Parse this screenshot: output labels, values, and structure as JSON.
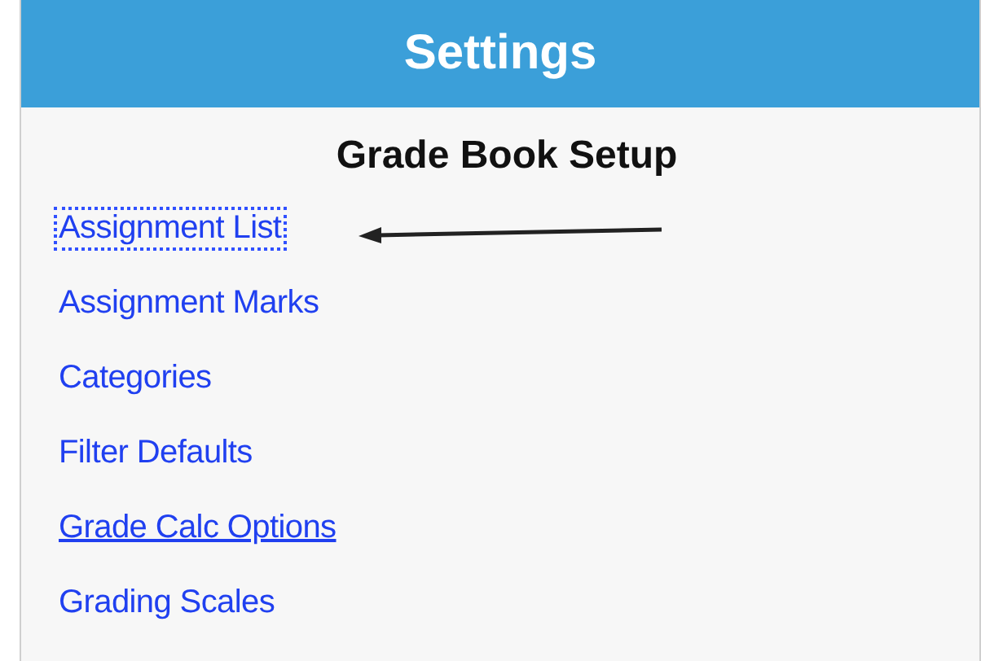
{
  "panel": {
    "title": "Settings",
    "heading": "Grade Book Setup"
  },
  "links": [
    {
      "label": "Assignment List",
      "focused": true,
      "hovered": false
    },
    {
      "label": "Assignment Marks",
      "focused": false,
      "hovered": false
    },
    {
      "label": "Categories",
      "focused": false,
      "hovered": false
    },
    {
      "label": "Filter Defaults",
      "focused": false,
      "hovered": false
    },
    {
      "label": "Grade Calc Options",
      "focused": false,
      "hovered": true
    },
    {
      "label": "Grading Scales",
      "focused": false,
      "hovered": false
    }
  ]
}
